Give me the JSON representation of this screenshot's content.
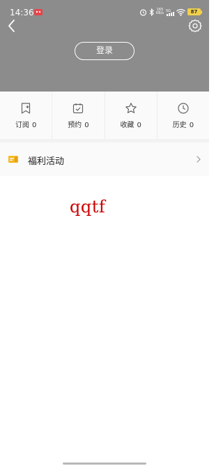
{
  "status_bar": {
    "time": "14:36",
    "battery": "87",
    "net_speed_top": "165",
    "net_speed_bottom": "KB/s",
    "signal_label": "5G"
  },
  "header": {
    "login_label": "登录",
    "back_icon": "chevron-left-icon",
    "settings_icon": "gear-icon"
  },
  "stats": [
    {
      "label": "订阅",
      "count": "0",
      "icon": "bookmark-add-icon"
    },
    {
      "label": "预约",
      "count": "0",
      "icon": "calendar-check-icon"
    },
    {
      "label": "收藏",
      "count": "0",
      "icon": "star-icon"
    },
    {
      "label": "历史",
      "count": "0",
      "icon": "clock-icon"
    }
  ],
  "benefits": {
    "label": "福利活动",
    "icon": "ticket-icon"
  },
  "handwritten_text": "qqtf",
  "colors": {
    "header_bg": "#8c8c8c",
    "accent_ticket": "#f5b821",
    "handwriting": "#cc0000"
  }
}
